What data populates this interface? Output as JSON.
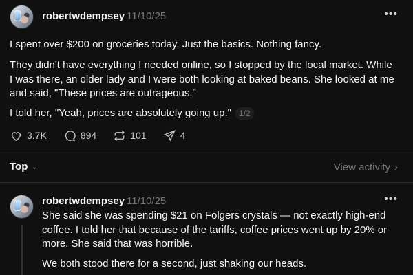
{
  "post": {
    "username": "robertwdempsey",
    "timestamp": "11/10/25",
    "paragraphs": [
      "I spent over $200 on groceries today. Just the basics. Nothing fancy.",
      "They didn't have everything I needed online, so I stopped by the local market. While I was there, an older lady and I were both looking at baked beans. She looked at me and said, \"These prices are outrageous.\"",
      "I told her, \"Yeah, prices are absolutely going up.\""
    ],
    "page_indicator": "1/2",
    "actions": {
      "likes": "3.7K",
      "replies": "894",
      "reposts": "101",
      "shares": "4"
    }
  },
  "replies_bar": {
    "sort_label": "Top",
    "view_activity_label": "View activity"
  },
  "reply": {
    "username": "robertwdempsey",
    "timestamp": "11/10/25",
    "paragraphs": [
      "She said she was spending $21 on Folgers crystals — not exactly high-end coffee. I told her that because of the tariffs, coffee prices went up by 20% or more. She said that was horrible.",
      "We both stood there for a second, just shaking our heads."
    ]
  },
  "icons": [
    "avatar",
    "more-icon",
    "heart-icon",
    "comment-icon",
    "repost-icon",
    "share-icon",
    "chevron-down-icon",
    "chevron-right-icon"
  ]
}
